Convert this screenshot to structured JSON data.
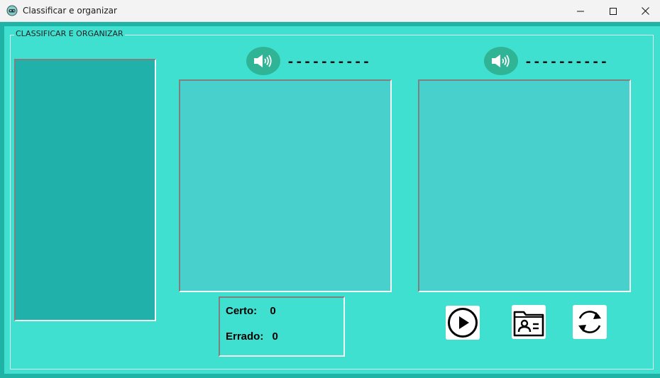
{
  "window": {
    "title": "Classificar e organizar",
    "app_icon": "gamepad-icon",
    "controls": [
      "minimize-icon",
      "maximize-icon",
      "close-icon"
    ]
  },
  "group": {
    "title": "CLASSIFICAR E ORGANIZAR"
  },
  "left_panel": {},
  "targets": [
    {
      "speaker_icon": "speaker-icon",
      "word": "----------"
    },
    {
      "speaker_icon": "speaker-icon",
      "word": "----------"
    }
  ],
  "score": {
    "correct_label": "Certo:",
    "correct_value": "0",
    "wrong_label": "Errado:",
    "wrong_value": "0"
  },
  "actions": [
    {
      "icon": "play-icon"
    },
    {
      "icon": "contact-folder-icon"
    },
    {
      "icon": "refresh-icon"
    }
  ],
  "colors": {
    "background": "#40e0d0",
    "left_panel": "#20b2aa",
    "drop_box": "#48d1cc",
    "speaker": "#2fb495",
    "outer_frame": "#1fb3a6"
  }
}
